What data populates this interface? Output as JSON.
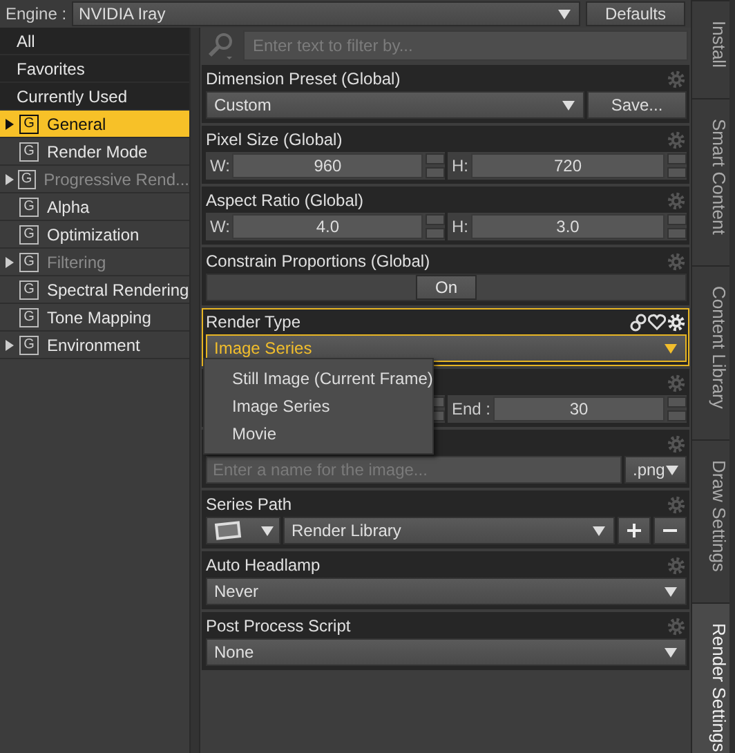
{
  "engine": {
    "label": "Engine :",
    "value": "NVIDIA Iray",
    "defaults_button": "Defaults"
  },
  "sidebar": {
    "items": [
      {
        "label": "All",
        "kind": "filter",
        "selected": false,
        "disabled": false
      },
      {
        "label": "Favorites",
        "kind": "filter",
        "selected": false,
        "disabled": false
      },
      {
        "label": "Currently Used",
        "kind": "filter",
        "selected": false,
        "disabled": false
      },
      {
        "label": "General",
        "kind": "category",
        "icon_letter": "G",
        "expandable": true,
        "selected": true,
        "disabled": false
      },
      {
        "label": "Render Mode",
        "kind": "category",
        "icon_letter": "G",
        "expandable": false,
        "selected": false,
        "disabled": false
      },
      {
        "label": "Progressive Rend...",
        "kind": "category",
        "icon_letter": "G",
        "expandable": true,
        "selected": false,
        "disabled": true
      },
      {
        "label": "Alpha",
        "kind": "category",
        "icon_letter": "G",
        "expandable": false,
        "selected": false,
        "disabled": false
      },
      {
        "label": "Optimization",
        "kind": "category",
        "icon_letter": "G",
        "expandable": false,
        "selected": false,
        "disabled": false
      },
      {
        "label": "Filtering",
        "kind": "category",
        "icon_letter": "G",
        "expandable": true,
        "selected": false,
        "disabled": true
      },
      {
        "label": "Spectral Rendering",
        "kind": "category",
        "icon_letter": "G",
        "expandable": false,
        "selected": false,
        "disabled": false
      },
      {
        "label": "Tone Mapping",
        "kind": "category",
        "icon_letter": "G",
        "expandable": false,
        "selected": false,
        "disabled": false
      },
      {
        "label": "Environment",
        "kind": "category",
        "icon_letter": "G",
        "expandable": true,
        "selected": false,
        "disabled": false
      }
    ]
  },
  "filter": {
    "placeholder": "Enter text to filter by..."
  },
  "properties": [
    {
      "kind": "dropdown",
      "label": "Dimension Preset (Global)",
      "value": "Custom",
      "button": "Save...",
      "focused": false
    },
    {
      "kind": "pair",
      "label": "Pixel Size (Global)",
      "fields": [
        {
          "label": "W:",
          "value": "960"
        },
        {
          "label": "H:",
          "value": "720"
        }
      ]
    },
    {
      "kind": "pair",
      "label": "Aspect Ratio (Global)",
      "fields": [
        {
          "label": "W:",
          "value": "4.0"
        },
        {
          "label": "H:",
          "value": "3.0"
        }
      ]
    },
    {
      "kind": "toggle",
      "label": "Constrain Proportions (Global)",
      "value": "On",
      "on": true
    },
    {
      "kind": "dropdown",
      "label": "Render Type",
      "value": "Image Series",
      "focused": true,
      "menu": [
        {
          "label": "Still Image (Current Frame)"
        },
        {
          "label": "Image Series"
        },
        {
          "label": "Movie"
        }
      ]
    },
    {
      "kind": "range",
      "fields": [
        {
          "label": "End :",
          "value": "30"
        }
      ]
    },
    {
      "kind": "filename",
      "placeholder": "Enter a name for the image...",
      "format": ".png"
    },
    {
      "kind": "path",
      "label": "Series Path",
      "value": "Render Library"
    },
    {
      "kind": "dropdown",
      "label": "Auto Headlamp",
      "value": "Never",
      "focused": false
    },
    {
      "kind": "dropdown",
      "label": "Post Process Script",
      "value": "None",
      "focused": false
    }
  ],
  "side_tabs": [
    {
      "label": "Install",
      "selected": false
    },
    {
      "label": "Smart Content",
      "selected": false
    },
    {
      "label": "Content Library",
      "selected": false
    },
    {
      "label": "Draw Settings",
      "selected": false
    },
    {
      "label": "Render Settings",
      "selected": true
    }
  ]
}
